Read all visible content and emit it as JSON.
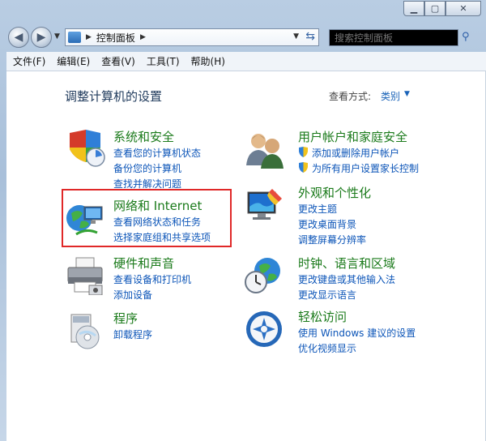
{
  "titlebar": {
    "title": "",
    "min": "▁",
    "max": "▢",
    "close": "✕"
  },
  "nav": {
    "breadcrumb": "控制面板",
    "search_placeholder": "搜索控制面板"
  },
  "menu": [
    "文件(F)",
    "编辑(E)",
    "查看(V)",
    "工具(T)",
    "帮助(H)"
  ],
  "content": {
    "title": "调整计算机的设置",
    "view_by_label": "查看方式:",
    "view_by_value": "类别"
  },
  "categories": [
    {
      "title": "系统和安全",
      "links": [
        "查看您的计算机状态",
        "备份您的计算机",
        "查找并解决问题"
      ]
    },
    {
      "title": "网络和 Internet",
      "links": [
        "查看网络状态和任务",
        "选择家庭组和共享选项"
      ]
    },
    {
      "title": "硬件和声音",
      "links": [
        "查看设备和打印机",
        "添加设备"
      ]
    },
    {
      "title": "程序",
      "links": [
        "卸载程序"
      ]
    },
    {
      "title": "用户帐户和家庭安全",
      "links": [
        "添加或删除用户帐户",
        "为所有用户设置家长控制"
      ]
    },
    {
      "title": "外观和个性化",
      "links": [
        "更改主题",
        "更改桌面背景",
        "调整屏幕分辨率"
      ]
    },
    {
      "title": "时钟、语言和区域",
      "links": [
        "更改键盘或其他输入法",
        "更改显示语言"
      ]
    },
    {
      "title": "轻松访问",
      "links": [
        "使用 Windows 建议的设置",
        "优化视频显示"
      ]
    }
  ],
  "colors": {
    "category_title": "#1a7a1a",
    "link": "#0c55b8",
    "highlight": "#e02828"
  }
}
